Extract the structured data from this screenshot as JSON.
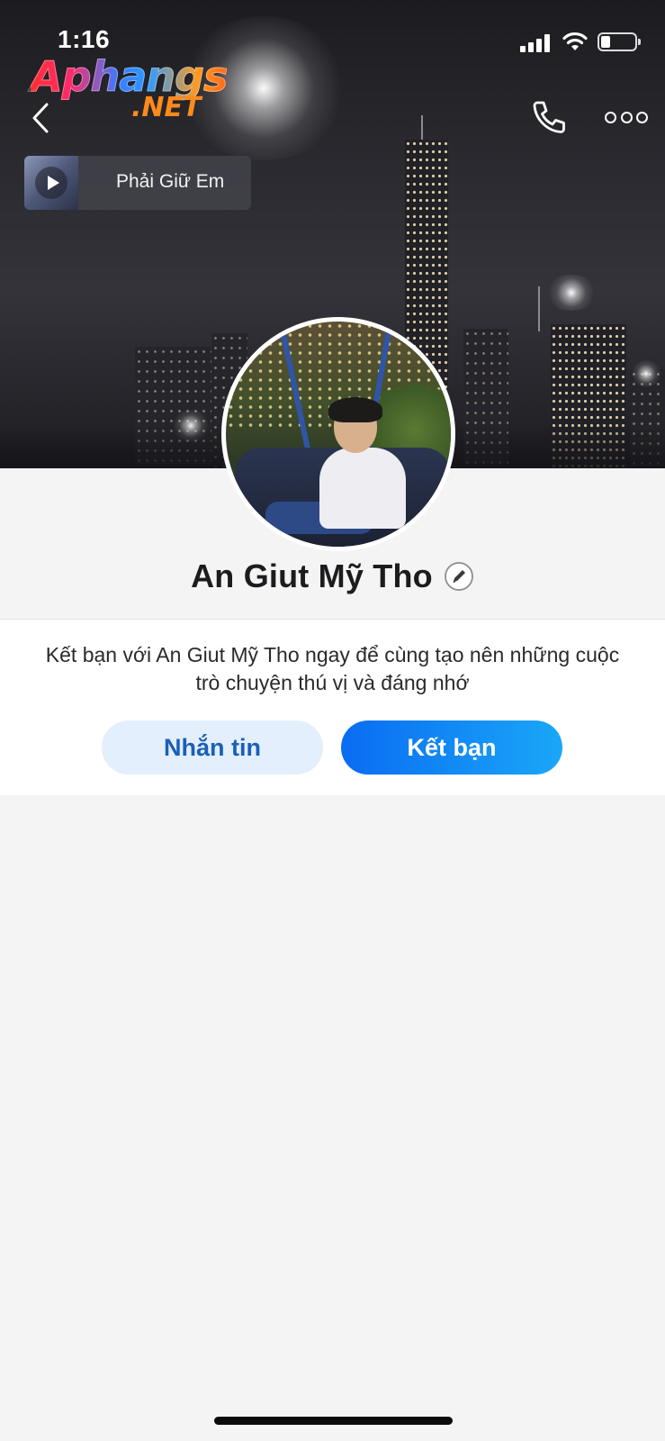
{
  "status_bar": {
    "time": "1:16",
    "signal_bars": 4,
    "battery_level": 0.25
  },
  "watermark": {
    "main": "Aphangs",
    "sub": ".NET"
  },
  "header": {
    "back_icon": "chevron-left-icon",
    "call_icon": "phone-icon",
    "more_icon": "more-dots-icon"
  },
  "music": {
    "title": "Phải Giữ Em",
    "play_icon": "play-icon"
  },
  "profile": {
    "name": "An Giut Mỹ Tho",
    "edit_icon": "pencil-icon"
  },
  "friend_card": {
    "message": "Kết bạn với An Giut Mỹ Tho ngay để cùng tạo nên những cuộc trò chuyện thú vị và đáng nhớ",
    "message_button": "Nhắn tin",
    "add_friend_button": "Kết bạn"
  },
  "colors": {
    "primary_blue": "#0a6cf2",
    "secondary_button_bg": "#e3effd",
    "secondary_button_text": "#1a5fb8",
    "page_bg": "#f4f4f5"
  }
}
